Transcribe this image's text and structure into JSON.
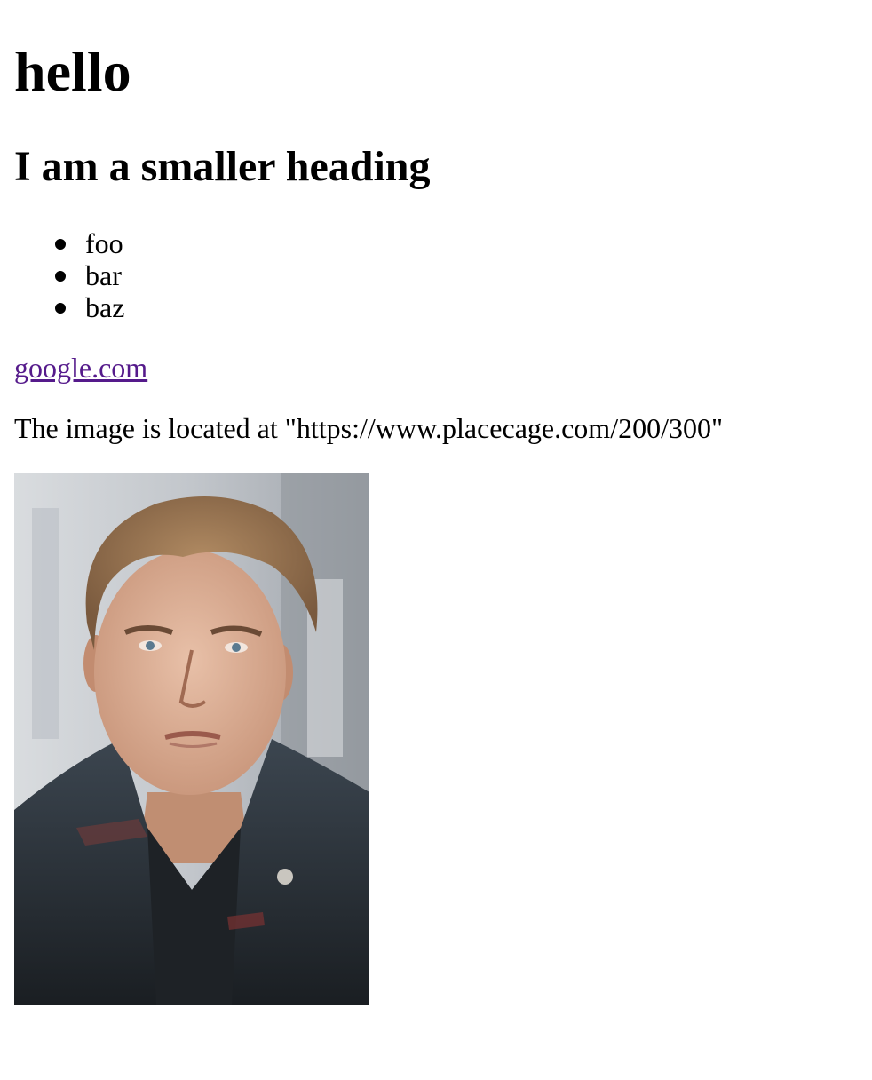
{
  "heading": "hello",
  "subheading": "I am a smaller heading",
  "list_items": [
    "foo",
    "bar",
    "baz"
  ],
  "link": {
    "text": "google.com",
    "color": "#551a8b"
  },
  "caption": "The image is located at \"https://www.placecage.com/200/300\"",
  "image": {
    "icon": "portrait-photo"
  }
}
